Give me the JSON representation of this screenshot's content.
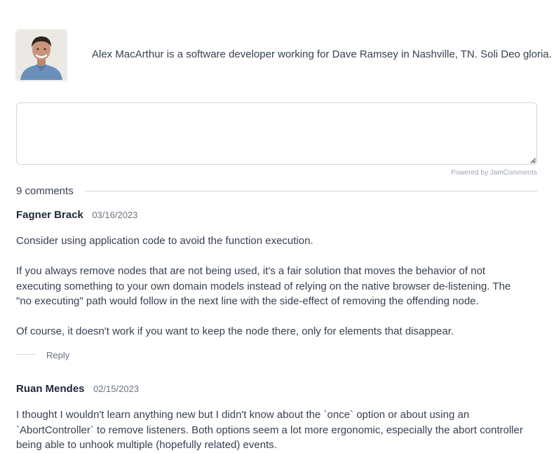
{
  "bio": {
    "text": "Alex MacArthur is a software developer working for Dave Ramsey in Nashville, TN. Soli Deo gloria."
  },
  "comment_form": {
    "value": "",
    "powered_by": "Powered by JamComments"
  },
  "comments_header": {
    "count_label": "9 comments"
  },
  "comments": [
    {
      "author": "Fagner Brack",
      "date": "03/16/2023",
      "paragraphs": [
        "Consider using application code to avoid the function execution.",
        "If you always remove nodes that are not being used, it's a fair solution that moves the behavior of not executing something to your own domain models instead of relying on the native browser de-listening. The \"no executing\" path would follow in the next line with the side-effect of removing the offending node.",
        "Of course, it doesn't work if you want to keep the node there, only for elements that disappear."
      ],
      "reply_label": "Reply"
    },
    {
      "author": "Ruan Mendes",
      "date": "02/15/2023",
      "paragraphs": [
        "I thought I wouldn't learn anything new but I didn't know about the `once` option or about using an `AbortController` to remove listeners. Both options seem a lot more ergonomic, especially the abort controller being able to unhook multiple (hopefully related) events."
      ]
    }
  ]
}
